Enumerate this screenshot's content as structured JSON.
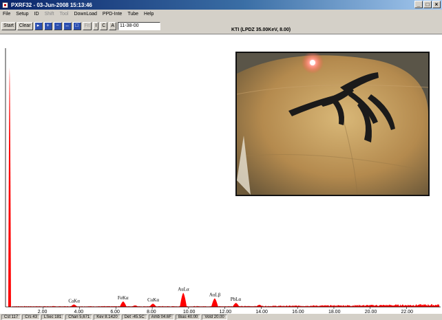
{
  "window": {
    "title": "PXRF32 - 03-Jun-2008 15:13:46",
    "controls": [
      "_",
      "□",
      "×"
    ]
  },
  "menu": [
    "File",
    "Setup",
    "ID",
    "Shift",
    "Tool",
    "DownLoad",
    "PPD-Inte",
    "Tube",
    "Help"
  ],
  "toolbar": {
    "start": "Start",
    "clear": "Clear",
    "icons": [
      "select-icon",
      "zoom-in-icon",
      "zoom-out-icon",
      "expand-icon",
      "fit-icon"
    ],
    "fit_label": "Fit",
    "i_label": "I",
    "c_label": "C",
    "a_label": "A",
    "time_value": "11-38-00"
  },
  "kti_label": "KTI  (LPDZ 35.00KeV, 8.00)",
  "status": [
    "Cst 117",
    "Crs 43",
    "LSec 181",
    "Chan 5,671",
    "Kev 8.1420",
    "Det -45.5C",
    "Amb 04.6F",
    "Bias 40.00",
    "Vold 20.00"
  ],
  "colors": {
    "spectrum": "#ff0000",
    "title_bar": "#0a246a",
    "chrome": "#d4d0c8"
  },
  "chart_data": {
    "type": "area",
    "xlabel": "",
    "ylabel": "",
    "x_ticks": [
      "2.00",
      "4.00",
      "6.00",
      "8.00",
      "10.00",
      "12.00",
      "14.00",
      "16.00",
      "18.00",
      "20.00",
      "22.00"
    ],
    "xlim": [
      0,
      23.8
    ],
    "ylim": [
      0,
      100
    ],
    "annotations": [
      {
        "label": "CaKα",
        "x": 3.69
      },
      {
        "label": "FeKα",
        "x": 6.4
      },
      {
        "label": "CuKα",
        "x": 8.04
      },
      {
        "label": "AuLα",
        "x": 9.71
      },
      {
        "label": "AuLβ",
        "x": 11.44
      },
      {
        "label": "PbLα",
        "x": 12.61
      }
    ],
    "peaks": [
      {
        "x": 0.15,
        "y": 95
      },
      {
        "x": 3.69,
        "y": 1.0
      },
      {
        "x": 6.4,
        "y": 2.2
      },
      {
        "x": 7.06,
        "y": 0.6
      },
      {
        "x": 8.04,
        "y": 1.3
      },
      {
        "x": 9.71,
        "y": 5.6
      },
      {
        "x": 11.44,
        "y": 3.4
      },
      {
        "x": 12.61,
        "y": 1.6
      },
      {
        "x": 13.9,
        "y": 0.9
      }
    ]
  }
}
